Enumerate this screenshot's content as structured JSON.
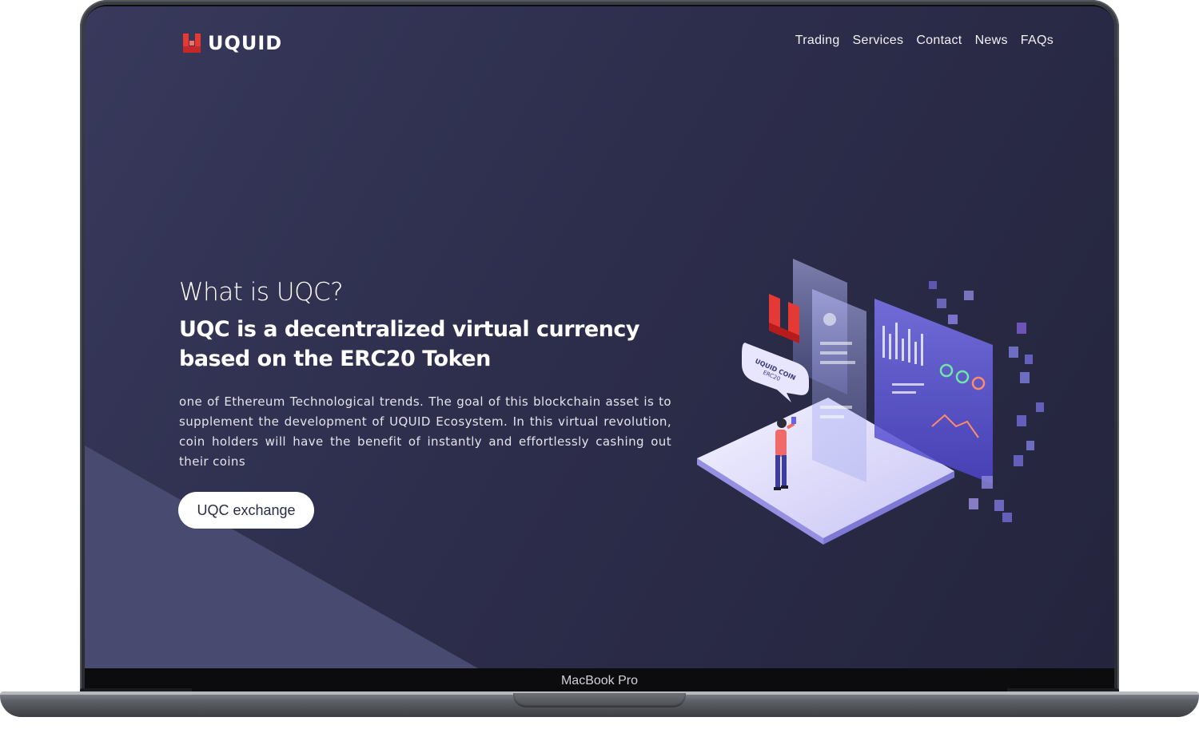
{
  "device": {
    "label": "MacBook Pro"
  },
  "header": {
    "logo_text": "UQUID",
    "nav": [
      {
        "label": "Trading"
      },
      {
        "label": "Services"
      },
      {
        "label": "Contact"
      },
      {
        "label": "News"
      },
      {
        "label": "FAQs"
      }
    ]
  },
  "hero": {
    "kicker": "What is UQC?",
    "title": "UQC is a decentralized virtual currency based on the ERC20 Token",
    "body": "one of Ethereum Technological trends. The goal of this blockchain asset is to supplement the development of UQUID Ecosystem. In this virtual revolution, coin holders will have the benefit of instantly and effortlessly cashing out their coins",
    "cta_label": "UQC exchange"
  },
  "illustration": {
    "badge_line1": "UQUID COIN",
    "badge_line2": "ERC20"
  },
  "colors": {
    "screen_bg": "#2d2e4c",
    "accent_red": "#e53935",
    "accent_purple": "#6b63e6"
  }
}
